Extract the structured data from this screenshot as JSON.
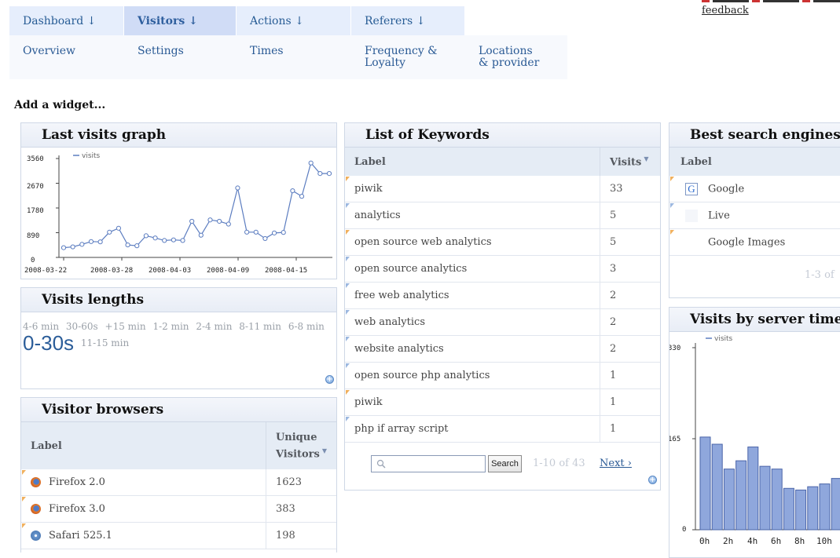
{
  "feedback": "feedback",
  "menu": {
    "main": [
      {
        "label": "Dashboard ↓",
        "active": false
      },
      {
        "label": "Visitors ↓",
        "active": true
      },
      {
        "label": "Actions ↓",
        "active": false
      },
      {
        "label": "Referers ↓",
        "active": false
      }
    ],
    "sub": [
      "Overview",
      "Settings",
      "Times",
      "Frequency & Loyalty",
      "Locations & provider"
    ]
  },
  "add_widget": "Add a widget...",
  "last_visits": {
    "title": "Last visits graph",
    "chart_data": {
      "type": "line",
      "series": [
        {
          "name": "visits",
          "values": [
            350,
            380,
            470,
            570,
            560,
            910,
            1050,
            450,
            420,
            780,
            700,
            610,
            630,
            610,
            1300,
            800,
            1350,
            1300,
            1200,
            2500,
            910,
            910,
            680,
            880,
            900,
            2400,
            2200,
            3400,
            3020,
            3020
          ]
        }
      ],
      "x_ticks": [
        "2008-03-22",
        "2008-03-28",
        "2008-04-03",
        "2008-04-09",
        "2008-04-15"
      ],
      "y_ticks": [
        "3560",
        "2670",
        "1780",
        "890",
        "0"
      ],
      "ylim": [
        0,
        3560
      ]
    }
  },
  "visits_lengths": {
    "title": "Visits lengths",
    "tags": [
      "4-6 min",
      "30-60s",
      "+15 min",
      "1-2 min",
      "2-4 min",
      "8-11 min",
      "6-8 min"
    ],
    "big_tag": "0-30s",
    "last_tag": "11-15 min"
  },
  "visitor_browsers": {
    "title": "Visitor browsers",
    "col_label": "Label",
    "col_value": "Unique Visitors",
    "rows": [
      {
        "label": "Firefox 2.0",
        "value": "1623",
        "icon": "firefox-icon"
      },
      {
        "label": "Firefox 3.0",
        "value": "383",
        "icon": "firefox-icon"
      },
      {
        "label": "Safari 525.1",
        "value": "198",
        "icon": "safari-icon"
      }
    ]
  },
  "keywords": {
    "title": "List of Keywords",
    "col_label": "Label",
    "col_value": "Visits",
    "rows": [
      {
        "label": "piwik",
        "value": "33"
      },
      {
        "label": "analytics",
        "value": "5"
      },
      {
        "label": "open source web analytics",
        "value": "5"
      },
      {
        "label": "open source analytics",
        "value": "3"
      },
      {
        "label": "free web analytics",
        "value": "2"
      },
      {
        "label": "web analytics",
        "value": "2"
      },
      {
        "label": "website analytics",
        "value": "2"
      },
      {
        "label": "open source php analytics",
        "value": "1"
      },
      {
        "label": "piwik",
        "value": "1"
      },
      {
        "label": "php if array script",
        "value": "1"
      }
    ],
    "search_placeholder": "",
    "search_button": "Search",
    "pagination": "1-10 of 43",
    "next": "Next ›"
  },
  "search_engines": {
    "title": "Best search engines",
    "col_label": "Label",
    "rows": [
      {
        "label": "Google",
        "icon": "google-icon"
      },
      {
        "label": "Live",
        "icon": "live-icon"
      },
      {
        "label": "Google Images",
        "icon": "google-images-icon"
      }
    ],
    "pagination": "1-3 of"
  },
  "server_time": {
    "title": "Visits by server time",
    "chart_data": {
      "type": "bar",
      "series": [
        {
          "name": "visits",
          "values": [
            168,
            155,
            110,
            125,
            150,
            115,
            110,
            75,
            72,
            78,
            83,
            93
          ]
        }
      ],
      "categories": [
        "0h",
        "1h",
        "2h",
        "3h",
        "4h",
        "5h",
        "6h",
        "7h",
        "8h",
        "9h",
        "10h",
        "11h"
      ],
      "x_ticks": [
        "0h",
        "2h",
        "4h",
        "6h",
        "8h",
        "10h"
      ],
      "y_ticks": [
        "330",
        "165",
        "0"
      ],
      "ylim": [
        0,
        330
      ]
    }
  },
  "colors": {
    "accent": "#2f5f9e",
    "series": "#5c7dc0",
    "bar": "#8fa7dc"
  }
}
